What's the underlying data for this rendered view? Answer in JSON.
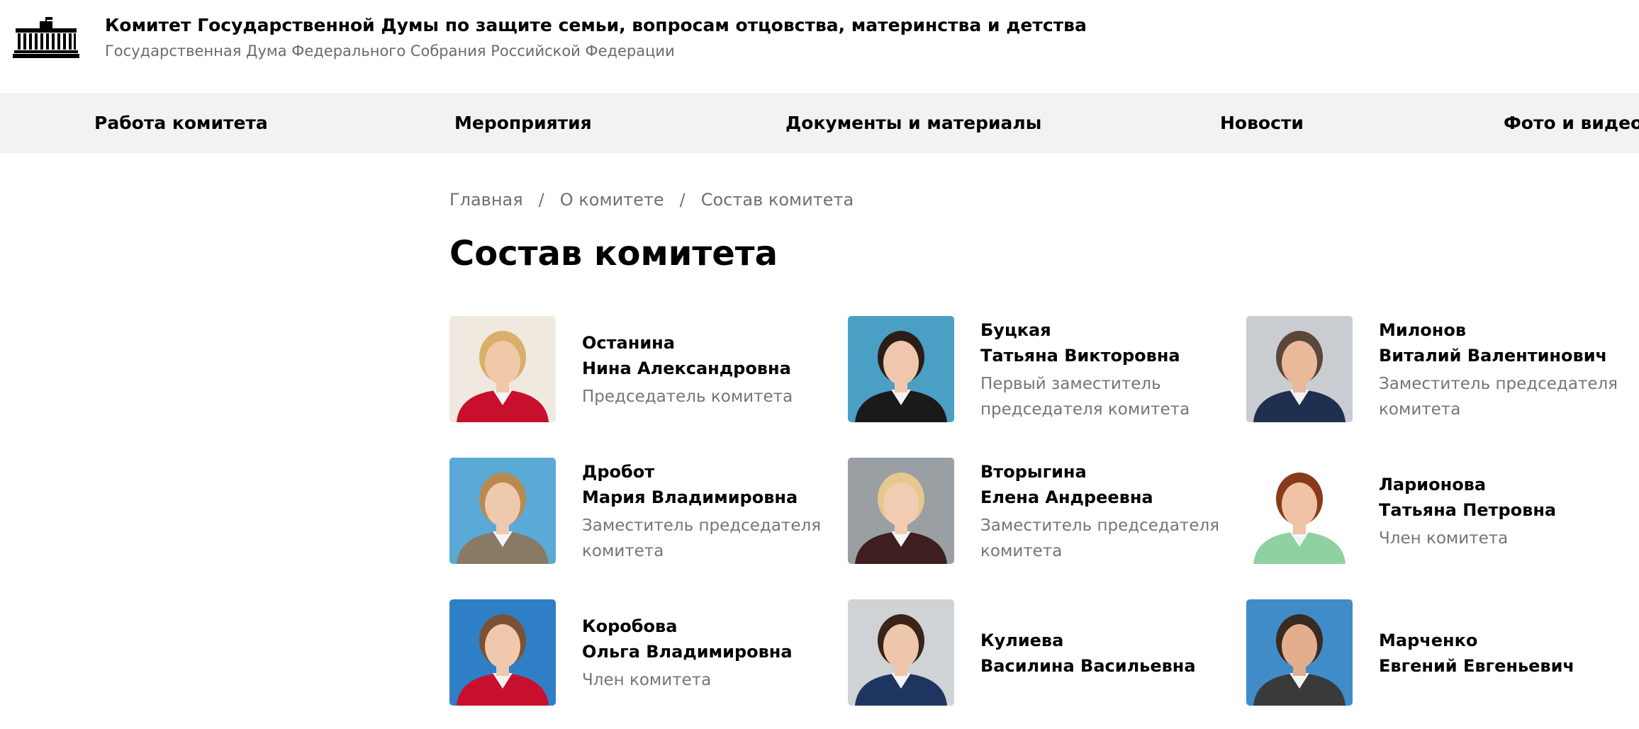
{
  "header": {
    "title": "Комитет Государственной Думы по защите семьи, вопросам отцовства, материнства и детства",
    "subtitle": "Государственная Дума Федерального Собрания Российской Федерации"
  },
  "nav": {
    "items": [
      "Работа комитета",
      "Мероприятия",
      "Документы и материалы",
      "Новости",
      "Фото и видео"
    ]
  },
  "breadcrumb": {
    "items": [
      "Главная",
      "О комитете",
      "Состав комитета"
    ],
    "separator": "/"
  },
  "page": {
    "title": "Состав комитета"
  },
  "members": [
    {
      "surname": "Останина",
      "given": "Нина Александровна",
      "role": "Председатель комитета",
      "photo": {
        "bg": "#efe9e0",
        "skin": "#f1c8a8",
        "hair": "#d9b06a",
        "suit": "#c8102e"
      }
    },
    {
      "surname": "Буцкая",
      "given": "Татьяна Викторовна",
      "role": "Первый заместитель председателя комитета",
      "photo": {
        "bg": "#4a9fc4",
        "skin": "#f0c7ad",
        "hair": "#2b1e17",
        "suit": "#1a1a1a"
      }
    },
    {
      "surname": "Милонов",
      "given": "Виталий Валентинович",
      "role": "Заместитель председателя комитета",
      "photo": {
        "bg": "#c9ccd1",
        "skin": "#e9b99a",
        "hair": "#5a463a",
        "suit": "#1f2f4f"
      }
    },
    {
      "surname": "Дробот",
      "given": "Мария Владимировна",
      "role": "Заместитель председателя комитета",
      "photo": {
        "bg": "#5aa9d6",
        "skin": "#efc9ad",
        "hair": "#b98a4e",
        "suit": "#8a7a65"
      }
    },
    {
      "surname": "Вторыгина",
      "given": "Елена Андреевна",
      "role": "Заместитель председателя комитета",
      "photo": {
        "bg": "#9a9fa3",
        "skin": "#f2cdb3",
        "hair": "#e6c78e",
        "suit": "#3e1e1e"
      }
    },
    {
      "surname": "Ларионова",
      "given": "Татьяна Петровна",
      "role": "Член комитета",
      "photo": {
        "bg": "#ffffff",
        "skin": "#f0c2a6",
        "hair": "#8a3a1c",
        "suit": "#8fd1a0"
      }
    },
    {
      "surname": "Коробова",
      "given": "Ольга Владимировна",
      "role": "Член комитета",
      "photo": {
        "bg": "#2f7fc7",
        "skin": "#f0c8ad",
        "hair": "#7a5233",
        "suit": "#c8102e"
      }
    },
    {
      "surname": "Кулиева",
      "given": "Василина Васильевна",
      "role": "",
      "photo": {
        "bg": "#cfd3d6",
        "skin": "#eec6ab",
        "hair": "#3a2418",
        "suit": "#1e3560"
      }
    },
    {
      "surname": "Марченко",
      "given": "Евгений Евгеньевич",
      "role": "",
      "photo": {
        "bg": "#3f8cc9",
        "skin": "#e2ae8e",
        "hair": "#3a2a20",
        "suit": "#3a3a3a"
      }
    }
  ]
}
